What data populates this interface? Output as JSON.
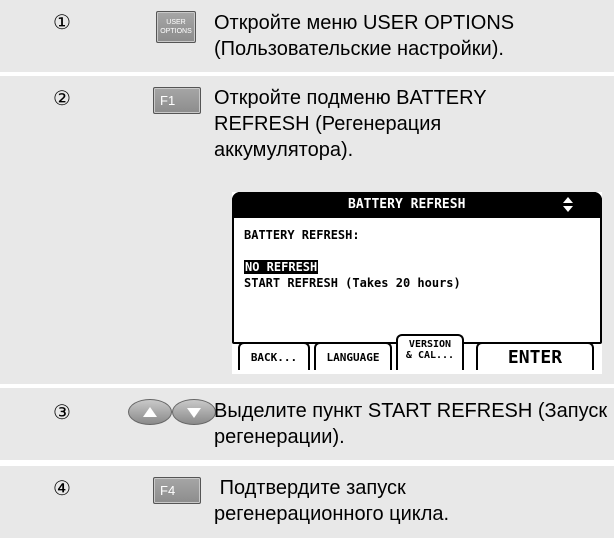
{
  "steps": [
    {
      "num": "①",
      "key_icon": "user-options-key",
      "key_label_line1": "USER",
      "key_label_line2": "OPTIONS",
      "text": "Откройте меню USER OPTIONS (Пользовательские настройки)."
    },
    {
      "num": "②",
      "key_icon": "f1-key",
      "key_label": "F1",
      "text": "Откройте подменю BATTERY REFRESH (Регенерация аккумулятора)."
    },
    {
      "num": "③",
      "key_icon": "up-down-arrow-keys",
      "text": "Выделите пункт START REFRESH (Запуск регенерации)."
    },
    {
      "num": "④",
      "key_icon": "f4-key",
      "key_label": "F4",
      "text": " Подтвердите запуск регенерационного цикла."
    }
  ],
  "screen": {
    "title": "BATTERY REFRESH",
    "heading": "BATTERY REFRESH:",
    "option_selected": "NO REFRESH",
    "option_other": "START REFRESH (Takes 20 hours)",
    "softkeys": {
      "back": "BACK...",
      "language": "LANGUAGE",
      "version_line1": "VERSION",
      "version_line2": "& CAL...",
      "enter": "ENTER"
    }
  },
  "colors": {
    "row_background": "#e8e8e8",
    "key_gray": "#999999",
    "screen_black": "#000000"
  }
}
